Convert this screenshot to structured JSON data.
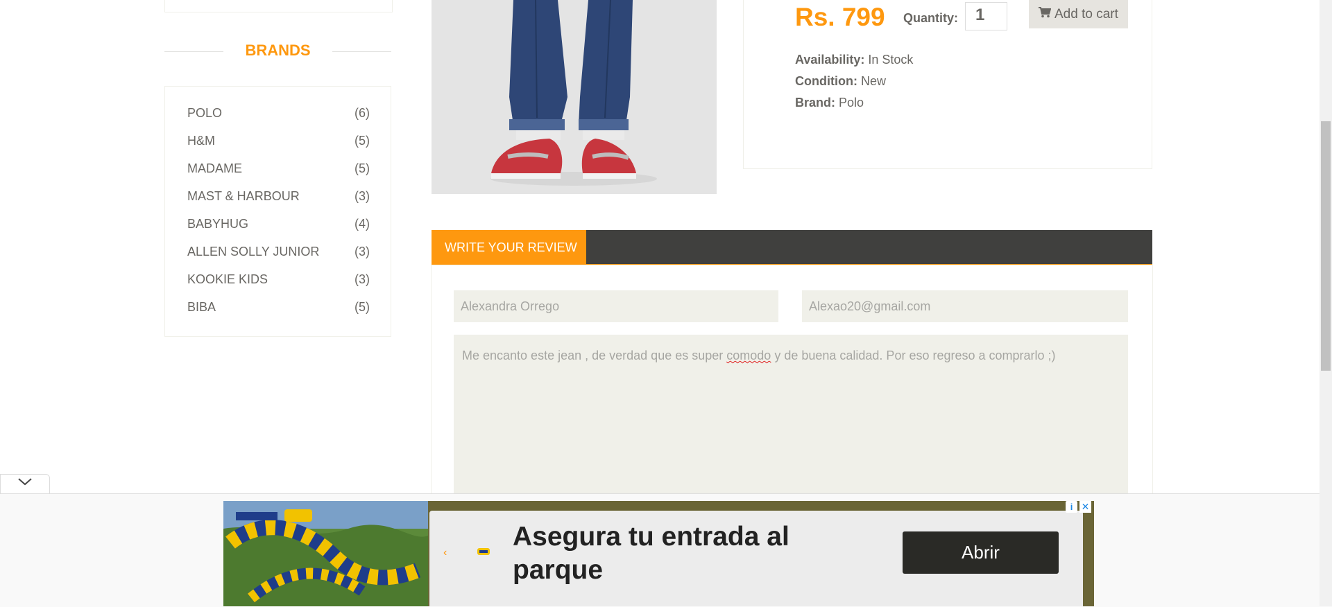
{
  "sidebar": {
    "brands_title": "BRANDS",
    "brands": [
      {
        "name": "POLO",
        "count": "(6)"
      },
      {
        "name": "H&M",
        "count": "(5)"
      },
      {
        "name": "MADAME",
        "count": "(5)"
      },
      {
        "name": "MAST & HARBOUR",
        "count": "(3)"
      },
      {
        "name": "BABYHUG",
        "count": "(4)"
      },
      {
        "name": "ALLEN SOLLY JUNIOR",
        "count": "(3)"
      },
      {
        "name": "KOOKIE KIDS",
        "count": "(3)"
      },
      {
        "name": "BIBA",
        "count": "(5)"
      }
    ]
  },
  "product": {
    "price": "Rs. 799",
    "quantity_label": "Quantity:",
    "quantity_value": "1",
    "add_to_cart": "Add to cart",
    "availability_label": "Availability:",
    "availability": "In Stock",
    "condition_label": "Condition:",
    "condition": "New",
    "brand_label": "Brand:",
    "brand": "Polo"
  },
  "review": {
    "tab_label": "WRITE YOUR REVIEW",
    "name_value": "Alexandra Orrego",
    "email_value": "Alexao20@gmail.com",
    "text_before": "Me encanto este jean , de verdad que es super ",
    "text_misspelled": "comodo",
    "text_after": " y de buena calidad. Por eso regreso a comprarlo ;)"
  },
  "ad": {
    "headline": "Asegura tu entrada al parque",
    "button": "Abrir",
    "info_icon": "info-icon",
    "close_icon": "close-icon"
  },
  "colors": {
    "accent": "#FE980F",
    "tab_bar": "#40403e",
    "field_bg": "#F0F0E9"
  }
}
